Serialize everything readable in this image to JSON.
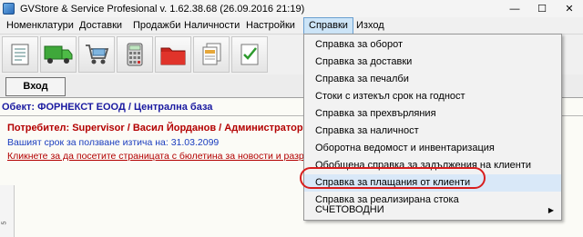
{
  "window": {
    "title": "GVStore & Service Profesional v. 1.62.38.68 (26.09.2016 21:19)",
    "controls": {
      "minimize": "—",
      "maximize": "☐",
      "close": "✕"
    }
  },
  "menubar": {
    "items": [
      {
        "label": "Номенклатури"
      },
      {
        "label": "Доставки"
      },
      {
        "label": "Продажби"
      },
      {
        "label": "Наличности"
      },
      {
        "label": "Настройки"
      },
      {
        "label": "Справки"
      },
      {
        "label": "Изход"
      }
    ],
    "active": "Справки"
  },
  "toolbar": {
    "buttons": [
      {
        "icon": "notepad-icon"
      },
      {
        "icon": "delivery-truck-icon"
      },
      {
        "icon": "shopping-cart-icon"
      },
      {
        "icon": "calculator-icon"
      },
      {
        "icon": "folder-icon"
      },
      {
        "icon": "documents-icon"
      },
      {
        "icon": "checklist-icon"
      }
    ]
  },
  "tabs": {
    "vhod": "Вход"
  },
  "content": {
    "object_line": "Обект: ФОРНЕКСТ ЕООД / Централна база",
    "user_line": "Потребител: Supervisor / Васил Йорданов / Администратор на",
    "expiry_line": "Вашият срок за ползване изтича на: 31.03.2099",
    "link_line": "Кликнете за да посетите страницата с бюлетина за новости и разработк",
    "ruler_number": "5"
  },
  "dropdown": {
    "items": [
      {
        "label": "Справка за оборот"
      },
      {
        "label": "Справка за доставки"
      },
      {
        "label": "Справка за печалби"
      },
      {
        "label": "Стоки с изтекъл срок на годност"
      },
      {
        "label": "Справка за прехвърляния"
      },
      {
        "label": "Справка за наличност"
      },
      {
        "label": "Оборотна ведомост и инвентаризация"
      },
      {
        "label": "Обобщена справка за задължения на клиенти"
      },
      {
        "label": "Справка за плащания от клиенти"
      },
      {
        "label": "Справка за реализирана стока"
      },
      {
        "label": "СЧЕТОВОДНИ",
        "submenu_arrow": "▶"
      }
    ],
    "highlighted": "Справка за плащания от клиенти"
  },
  "colors": {
    "highlight_oval": "#d81e1e",
    "menu_active_bg": "#cce4f7",
    "object_text": "#1a1aa0",
    "user_text": "#b30000",
    "expiry_text": "#1a3dbf"
  }
}
